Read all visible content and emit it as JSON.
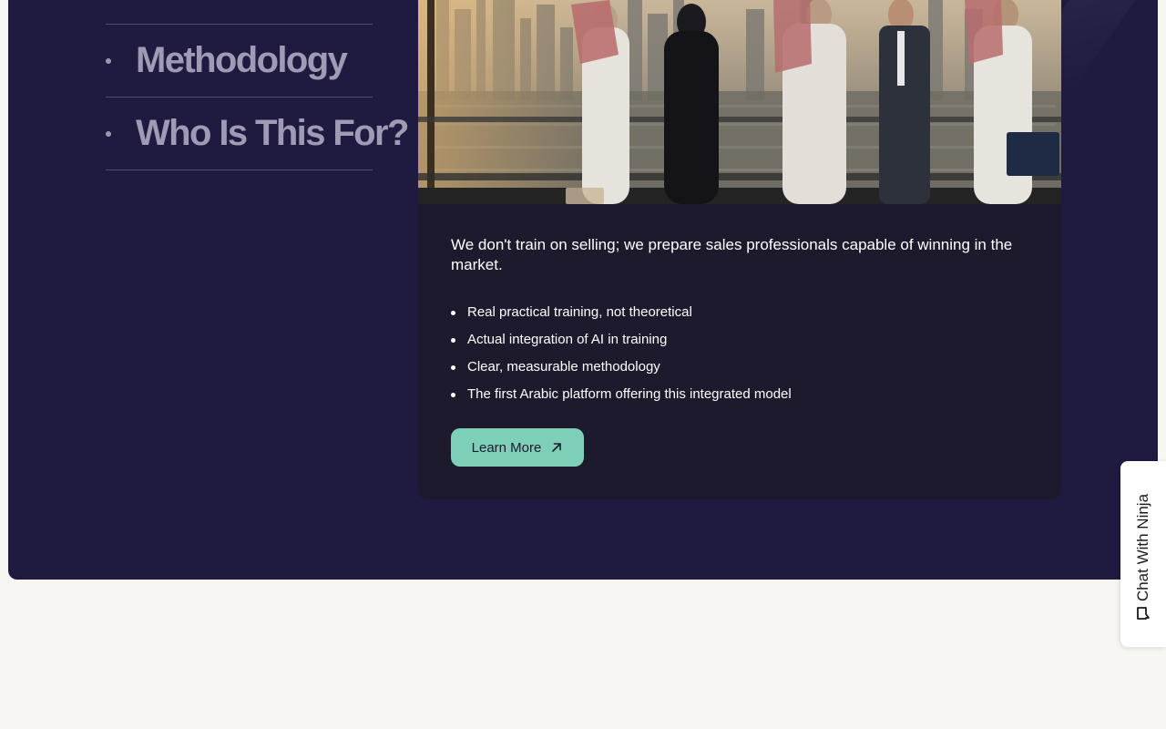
{
  "side_nav": {
    "items": [
      {
        "label": "Methodology"
      },
      {
        "label": "Who Is This For?"
      }
    ]
  },
  "card": {
    "image_alt": "Group of business professionals in traditional Gulf attire talking in front of a city skyline",
    "intro": "We don't train on selling; we prepare sales professionals capable of winning in the market.",
    "bullets": [
      "Real practical training, not theoretical",
      "Actual integration of AI in training",
      "Clear, measurable methodology",
      "The first Arabic platform offering this integrated model"
    ],
    "button_label": "Learn More",
    "button_icon": "arrow-up-right-icon"
  },
  "chat": {
    "label": "Chat With Ninja",
    "icon": "chat-bubble-icon"
  },
  "colors": {
    "section_bg": "#1f1a40",
    "card_bg": "#1d1a2e",
    "accent": "#7ecfb8",
    "page_bg": "#f7f6f2",
    "nav_text": "#9f9bb4"
  }
}
